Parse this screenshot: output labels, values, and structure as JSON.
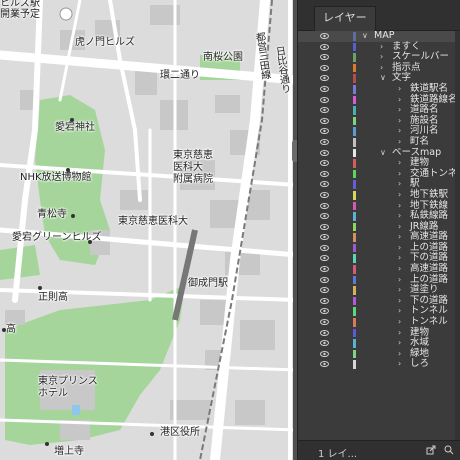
{
  "map": {
    "labels": [
      {
        "id": "station-top",
        "text": "ヒルズ駅"
      },
      {
        "id": "open-plan",
        "text": "開業予定"
      },
      {
        "id": "toranomon-hills",
        "text": "虎ノ門ヒルズ"
      },
      {
        "id": "nanou-park",
        "text": "南桜公園"
      },
      {
        "id": "loop2",
        "text": "環二通り"
      },
      {
        "id": "atago-shrine",
        "text": "愛宕神社"
      },
      {
        "id": "nhk-museum",
        "text": "NHK放送博物館"
      },
      {
        "id": "jikei-hosp",
        "text": "東京慈恵\n医科大\n附属病院"
      },
      {
        "id": "seishoji",
        "text": "青松寺"
      },
      {
        "id": "jikei-univ",
        "text": "東京慈恵医科大"
      },
      {
        "id": "atago-green",
        "text": "愛宕グリーンヒルズ"
      },
      {
        "id": "onarimon-st",
        "text": "御成門駅"
      },
      {
        "id": "shoho",
        "text": "正則高"
      },
      {
        "id": "high-school",
        "text": "高"
      },
      {
        "id": "prince-hotel",
        "text": "東京プリンス\nホテル"
      },
      {
        "id": "minato-office",
        "text": "港区役所"
      },
      {
        "id": "zojoji",
        "text": "増上寺"
      }
    ],
    "vertical_labels": [
      {
        "id": "hibiya-dori",
        "text": "日比谷通り"
      },
      {
        "id": "toei-mita",
        "text": "都営三田線"
      }
    ],
    "colors": {
      "block": "#d9d9d9",
      "road": "#ffffff",
      "park": "#a5d59b",
      "building": "#c6c6c6",
      "rail": "#8c8c8c"
    }
  },
  "panel": {
    "tab_label": "レイヤー",
    "footer_label": "1 レイ...",
    "layers": [
      {
        "name": "MAP",
        "indent": 0,
        "twirl": "down",
        "color": "#5b6f9e",
        "selected": true
      },
      {
        "name": "ますく",
        "indent": 1,
        "twirl": "right",
        "color": "#5b5bd6"
      },
      {
        "name": "スケールバー",
        "indent": 1,
        "twirl": "right",
        "color": "#6aa36a"
      },
      {
        "name": "指示点",
        "indent": 1,
        "twirl": "right",
        "color": "#e07a2b"
      },
      {
        "name": "文字",
        "indent": 1,
        "twirl": "down",
        "color": "#b74b4b"
      },
      {
        "name": "鉄道駅名",
        "indent": 2,
        "twirl": "right",
        "color": "#7a7ad6"
      },
      {
        "name": "鉄道路線名",
        "indent": 2,
        "twirl": "right",
        "color": "#d65bd6"
      },
      {
        "name": "道路名",
        "indent": 2,
        "twirl": "right",
        "color": "#4bb0b0"
      },
      {
        "name": "施設名",
        "indent": 2,
        "twirl": "right",
        "color": "#7fd47f"
      },
      {
        "name": "河川名",
        "indent": 2,
        "twirl": "right",
        "color": "#5b9bd6"
      },
      {
        "name": "町名",
        "indent": 2,
        "twirl": "right",
        "color": "#c0c0c0"
      },
      {
        "name": "ベースmap",
        "indent": 1,
        "twirl": "down",
        "color": "#e6e6e6"
      },
      {
        "name": "建物",
        "indent": 2,
        "twirl": "right",
        "color": "#d65b5b"
      },
      {
        "name": "交通トンネル",
        "indent": 2,
        "twirl": "right",
        "color": "#5bd65b"
      },
      {
        "name": "駅",
        "indent": 2,
        "twirl": "right",
        "color": "#6b5bd6"
      },
      {
        "name": "地下鉄駅",
        "indent": 2,
        "twirl": "right",
        "color": "#d6d65b"
      },
      {
        "name": "地下鉄線",
        "indent": 2,
        "twirl": "right",
        "color": "#d65bb0"
      },
      {
        "name": "私鉄線路",
        "indent": 2,
        "twirl": "right",
        "color": "#5bb0d6"
      },
      {
        "name": "JR線路",
        "indent": 2,
        "twirl": "right",
        "color": "#8fd65b"
      },
      {
        "name": "高速道路",
        "indent": 2,
        "twirl": "right",
        "color": "#d6905b"
      },
      {
        "name": "上の道路",
        "indent": 2,
        "twirl": "right",
        "color": "#9b5bd6"
      },
      {
        "name": "下の道路",
        "indent": 2,
        "twirl": "right",
        "color": "#5bd6b0"
      },
      {
        "name": "高速道路",
        "indent": 2,
        "twirl": "right",
        "color": "#d65b7a"
      },
      {
        "name": "上の道路",
        "indent": 2,
        "twirl": "right",
        "color": "#5b7ad6"
      },
      {
        "name": "道塗り",
        "indent": 2,
        "twirl": "right",
        "color": "#d6b05b"
      },
      {
        "name": "下の道路",
        "indent": 2,
        "twirl": "right",
        "color": "#b05bd6"
      },
      {
        "name": "トンネル",
        "indent": 2,
        "twirl": "right",
        "color": "#5bd67a"
      },
      {
        "name": "トンネル",
        "indent": 2,
        "twirl": "right",
        "color": "#d67a5b"
      },
      {
        "name": "建物",
        "indent": 2,
        "twirl": "right",
        "color": "#5b5bd6"
      },
      {
        "name": "水域",
        "indent": 2,
        "twirl": "right",
        "color": "#5bb0d6"
      },
      {
        "name": "緑地",
        "indent": 2,
        "twirl": "right",
        "color": "#7fd47f"
      },
      {
        "name": "しろ",
        "indent": 2,
        "twirl": "right",
        "color": "#d6d6d6"
      }
    ]
  }
}
